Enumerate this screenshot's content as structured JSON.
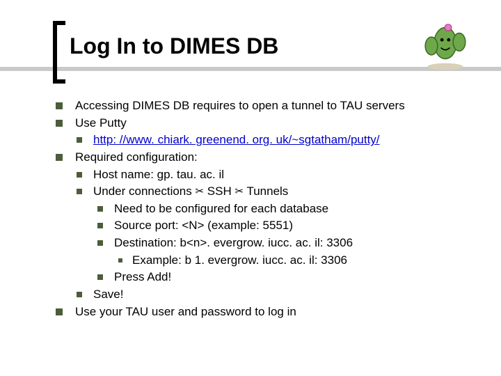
{
  "title": "Log In to DIMES DB",
  "bullets": {
    "b0": "Accessing DIMES DB requires to open a tunnel to TAU servers",
    "b1": "Use Putty",
    "b1a_link": "http: //www. chiark. greenend. org. uk/~sgtatham/putty/",
    "b2": "Required configuration:",
    "b2a": "Host name: gp. tau. ac. il",
    "b2b_pre": "Under connections ",
    "b2b_mid": " SSH ",
    "b2b_post": " Tunnels",
    "b2b_i": "Need to be configured for each database",
    "b2b_ii": "Source port: <N> (example: 5551)",
    "b2b_iii": "Destination: b<n>. evergrow. iucc. ac. il: 3306",
    "b2b_iii_ex": "Example: b 1. evergrow. iucc. ac. il: 3306",
    "b2b_iv": "Press Add!",
    "b2c": "Save!",
    "b3": "Use your TAU user and password to log in"
  }
}
